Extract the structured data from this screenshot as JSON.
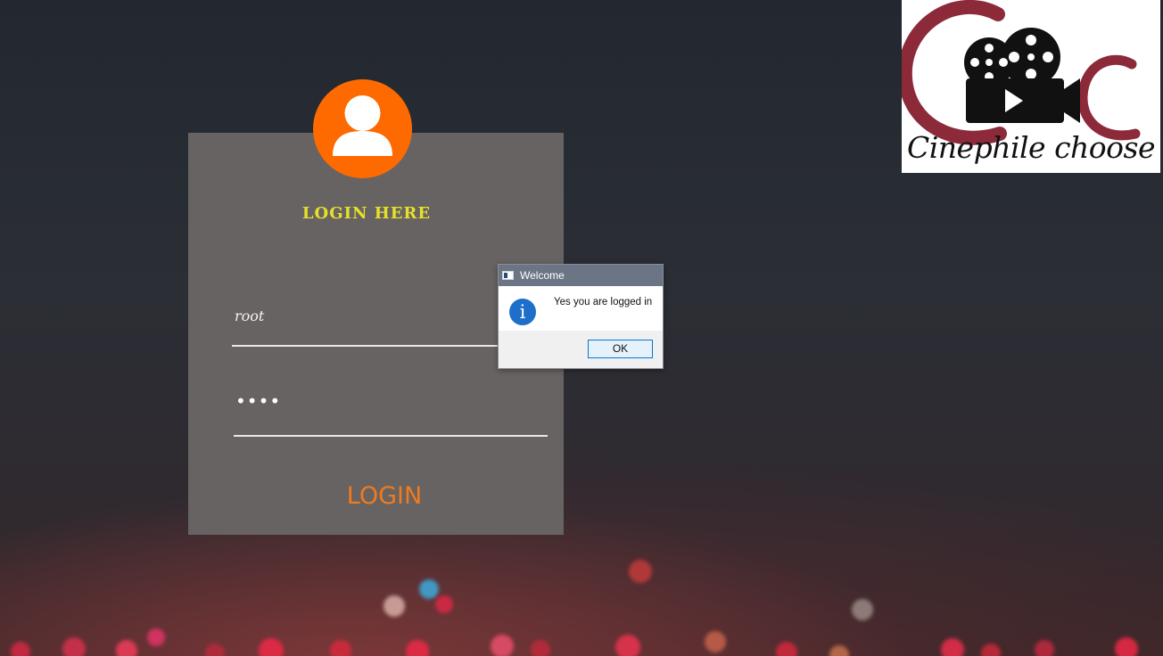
{
  "login_panel": {
    "title": "LOGIN HERE",
    "username_value": "root",
    "password_masked": "••••",
    "login_button_label": "LOGIN"
  },
  "logo": {
    "text": "Cinephile choose"
  },
  "dialog": {
    "title": "Welcome",
    "message": "Yes you are logged in",
    "info_icon_glyph": "i",
    "ok_label": "OK"
  },
  "icons": {
    "avatar": "user-icon",
    "dialog_info": "info-icon",
    "dialog_title": "window-icon",
    "logo": "film-camera-icon"
  },
  "colors": {
    "panel_bg": "#676362",
    "avatar_bg": "#ff6a00",
    "title_color": "#e6e02a",
    "login_button_color": "#f07a1d",
    "dialog_titlebar": "#6b7585",
    "info_icon_bg": "#1d6fc9",
    "logo_c_color": "#8c2a3a"
  }
}
